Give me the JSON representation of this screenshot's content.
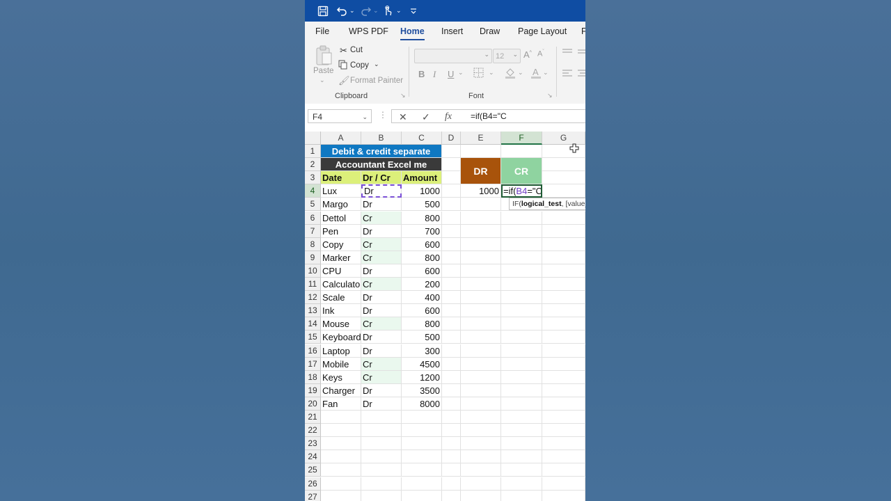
{
  "titlebar": {
    "icons": [
      "save-icon",
      "undo-icon",
      "redo-icon",
      "touch-mode-icon",
      "customize-icon"
    ]
  },
  "tabs": [
    "File",
    "WPS PDF",
    "Home",
    "Insert",
    "Draw",
    "Page Layout",
    "F"
  ],
  "active_tab": "Home",
  "ribbon": {
    "clipboard": {
      "paste": "Paste",
      "cut": "Cut",
      "copy": "Copy",
      "format_painter": "Format Painter",
      "label": "Clipboard"
    },
    "font": {
      "font_name": "",
      "font_size": "12",
      "label": "Font",
      "bold": "B",
      "italic": "I",
      "underline": "U"
    }
  },
  "formula_bar": {
    "name_box": "F4",
    "cancel": "✕",
    "enter": "✓",
    "fx": "fx",
    "formula": "=if(B4=\"C"
  },
  "columns": [
    "A",
    "B",
    "C",
    "D",
    "E",
    "F",
    "G"
  ],
  "rows": [
    "1",
    "2",
    "3",
    "4",
    "5",
    "6",
    "7",
    "8",
    "9",
    "10",
    "11",
    "12",
    "13",
    "14",
    "15",
    "16",
    "17",
    "18",
    "19",
    "20",
    "21",
    "22",
    "23",
    "24",
    "25",
    "26",
    "27"
  ],
  "sheet": {
    "title": "Debit & credit separate",
    "subtitle": "Accountant Excel me",
    "headers": {
      "date": "Date",
      "drcr": "Dr / Cr",
      "amount": "Amount"
    },
    "dr_label": "DR",
    "cr_label": "CR",
    "e4_value": "1000",
    "f4_editing": "=if(B4=\"C",
    "f4_prefix": "=if(",
    "f4_ref": "B4",
    "f4_suffix": "=\"C",
    "tooltip_prefix": "IF(",
    "tooltip_bold": "logical_test",
    "tooltip_rest": ", [value_",
    "items": [
      {
        "date": "Lux",
        "drcr": "Dr",
        "amount": "1000"
      },
      {
        "date": "Margo",
        "drcr": "Dr",
        "amount": "500"
      },
      {
        "date": "Dettol",
        "drcr": "Cr",
        "amount": "800"
      },
      {
        "date": "Pen",
        "drcr": "Dr",
        "amount": "700"
      },
      {
        "date": "Copy",
        "drcr": "Cr",
        "amount": "600"
      },
      {
        "date": "Marker",
        "drcr": "Cr",
        "amount": "800"
      },
      {
        "date": "CPU",
        "drcr": "Dr",
        "amount": "600"
      },
      {
        "date": "Calculato",
        "drcr": "Cr",
        "amount": "200"
      },
      {
        "date": "Scale",
        "drcr": "Dr",
        "amount": "400"
      },
      {
        "date": "Ink",
        "drcr": "Dr",
        "amount": "600"
      },
      {
        "date": "Mouse",
        "drcr": "Cr",
        "amount": "800"
      },
      {
        "date": "Keyboard",
        "drcr": "Dr",
        "amount": "500"
      },
      {
        "date": "Laptop",
        "drcr": "Dr",
        "amount": "300"
      },
      {
        "date": "Mobile",
        "drcr": "Cr",
        "amount": "4500"
      },
      {
        "date": "Keys",
        "drcr": "Cr",
        "amount": "1200"
      },
      {
        "date": "Charger",
        "drcr": "Dr",
        "amount": "3500"
      },
      {
        "date": "Fan",
        "drcr": "Dr",
        "amount": "8000"
      }
    ]
  },
  "colors": {
    "title_bar": "#0f4da3",
    "sheet_title": "#0f78c2",
    "subtitle": "#3a3a3a",
    "header_fill": "#dcf07a",
    "dr_fill": "#a8530b",
    "cr_fill": "#8fd3a0"
  }
}
